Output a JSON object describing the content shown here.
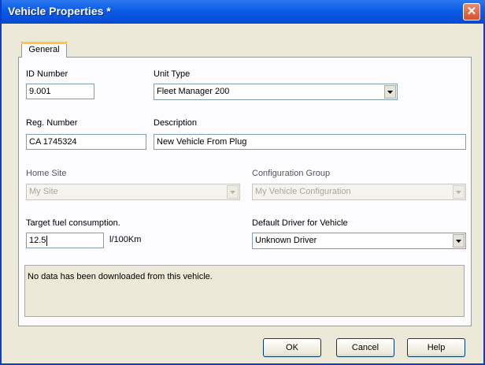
{
  "window": {
    "title": "Vehicle Properties *",
    "close_icon": "close-icon"
  },
  "tabs": [
    {
      "label": "General",
      "selected": true
    }
  ],
  "fields": {
    "id_number": {
      "label": "ID Number",
      "value": "9.001"
    },
    "unit_type": {
      "label": "Unit Type",
      "value": "Fleet Manager 200"
    },
    "reg_number": {
      "label": "Reg. Number",
      "value": "CA 1745324"
    },
    "description": {
      "label": "Description",
      "value": "New Vehicle From Plug"
    },
    "home_site": {
      "label": "Home Site",
      "value": "My Site",
      "enabled": false
    },
    "configuration_group": {
      "label": "Configuration Group",
      "value": "My Vehicle Configuration",
      "enabled": false
    },
    "target_fuel": {
      "label": "Target fuel consumption.",
      "value": "12.5",
      "unit": "l/100Km"
    },
    "default_driver": {
      "label": "Default Driver for Vehicle",
      "value": "Unknown Driver"
    }
  },
  "info_text": "No data has been downloaded from this vehicle.",
  "buttons": {
    "ok": "OK",
    "cancel": "Cancel",
    "help": "Help"
  },
  "colors": {
    "titlebar": "#0a5ce8",
    "dialog_bg": "#ece9d8",
    "close_button": "#d8502c"
  }
}
